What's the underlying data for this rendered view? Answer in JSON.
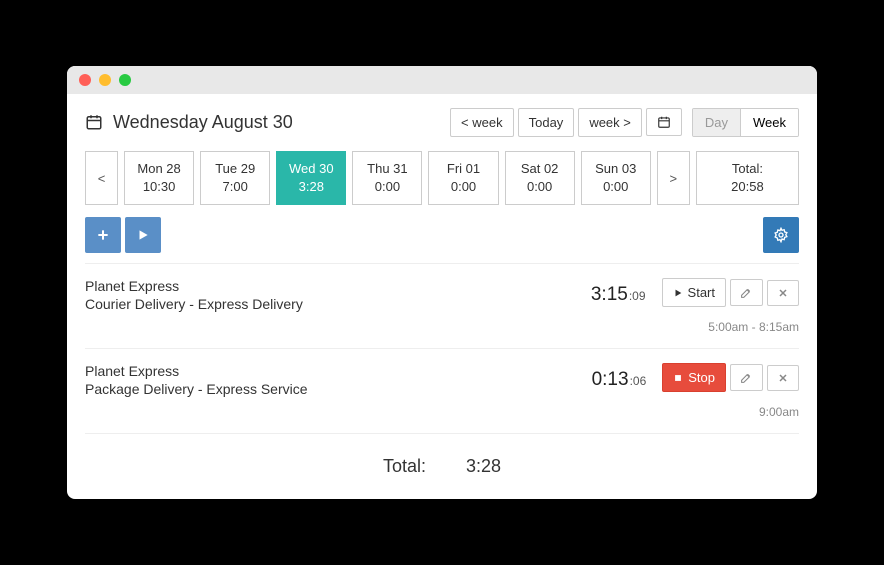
{
  "header": {
    "title": "Wednesday August 30",
    "prev_week": "< week",
    "today": "Today",
    "next_week": "week >",
    "view_day": "Day",
    "view_week": "Week"
  },
  "days": {
    "items": [
      {
        "label": "Mon 28",
        "time": "10:30",
        "active": false
      },
      {
        "label": "Tue 29",
        "time": "7:00",
        "active": false
      },
      {
        "label": "Wed 30",
        "time": "3:28",
        "active": true
      },
      {
        "label": "Thu 31",
        "time": "0:00",
        "active": false
      },
      {
        "label": "Fri 01",
        "time": "0:00",
        "active": false
      },
      {
        "label": "Sat 02",
        "time": "0:00",
        "active": false
      },
      {
        "label": "Sun 03",
        "time": "0:00",
        "active": false
      }
    ],
    "prev": "<",
    "next": ">",
    "total_label": "Total:",
    "total_value": "20:58"
  },
  "entries": [
    {
      "client": "Planet Express",
      "desc": "Courier Delivery - Express Delivery",
      "time_main": "3:15",
      "time_sec": ":09",
      "action_label": "Start",
      "running": false,
      "range": "5:00am - 8:15am"
    },
    {
      "client": "Planet Express",
      "desc": "Package Delivery - Express Service",
      "time_main": "0:13",
      "time_sec": ":06",
      "action_label": "Stop",
      "running": true,
      "range": "9:00am"
    }
  ],
  "footer": {
    "total_label": "Total:",
    "total_value": "3:28"
  }
}
